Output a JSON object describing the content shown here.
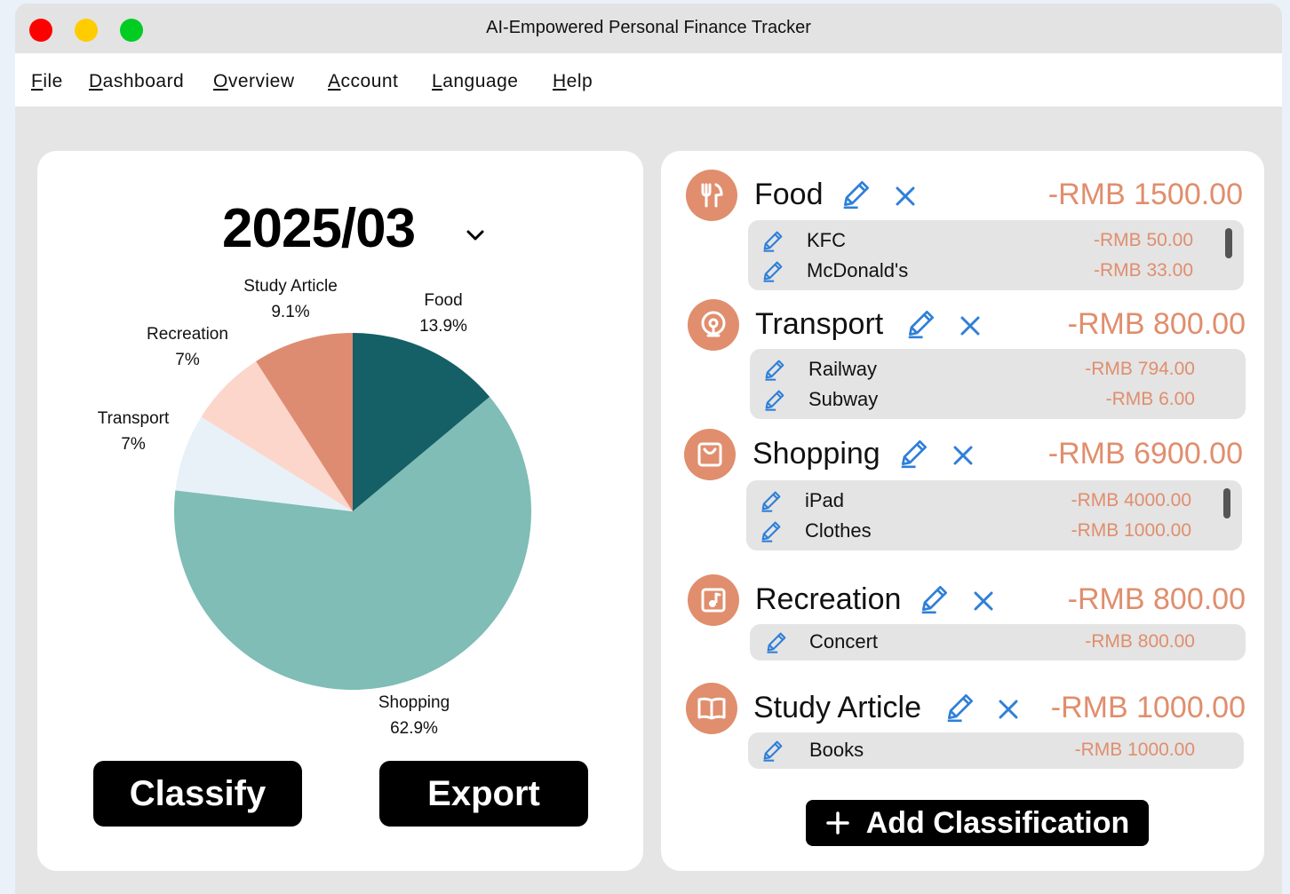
{
  "window": {
    "title": "AI-Empowered Personal Finance Tracker"
  },
  "menu": [
    {
      "key": "F",
      "rest": "ile"
    },
    {
      "key": "D",
      "rest": "ashboard"
    },
    {
      "key": "O",
      "rest": "verview"
    },
    {
      "key": "A",
      "rest": "ccount"
    },
    {
      "key": "L",
      "rest": "anguage"
    },
    {
      "key": "H",
      "rest": "elp"
    }
  ],
  "period": "2025/03",
  "buttons": {
    "classify": "Classify",
    "export": "Export",
    "add_classification": "Add Classification"
  },
  "chart_data": {
    "type": "pie",
    "slices": [
      {
        "label": "Food",
        "pct_label": "13.9%",
        "value": 13.9,
        "color": "#155f66"
      },
      {
        "label": "Shopping",
        "pct_label": "62.9%",
        "value": 62.9,
        "color": "#7fbdb6"
      },
      {
        "label": "Transport",
        "pct_label": "7%",
        "value": 7.0,
        "color": "#e8f1f8"
      },
      {
        "label": "Recreation",
        "pct_label": "7%",
        "value": 7.0,
        "color": "#fcd6cb"
      },
      {
        "label": "Study Article",
        "pct_label": "9.1%",
        "value": 9.1,
        "color": "#de8c71"
      }
    ]
  },
  "categories": [
    {
      "name": "Food",
      "icon": "utensils-icon",
      "total": "-RMB 1500.00",
      "items": [
        {
          "name": "KFC",
          "amount": "-RMB 50.00"
        },
        {
          "name": "McDonald's",
          "amount": "-RMB 33.00"
        }
      ],
      "scroll": true
    },
    {
      "name": "Transport",
      "icon": "train-icon",
      "total": "-RMB 800.00",
      "items": [
        {
          "name": "Railway",
          "amount": "-RMB 794.00"
        },
        {
          "name": "Subway",
          "amount": "-RMB 6.00"
        }
      ],
      "scroll": false
    },
    {
      "name": "Shopping",
      "icon": "shopping-bag-icon",
      "total": "-RMB 6900.00",
      "items": [
        {
          "name": "iPad",
          "amount": "-RMB 4000.00"
        },
        {
          "name": "Clothes",
          "amount": "-RMB 1000.00"
        }
      ],
      "scroll": true
    },
    {
      "name": "Recreation",
      "icon": "music-note-icon",
      "total": "-RMB 800.00",
      "items": [
        {
          "name": "Concert",
          "amount": "-RMB 800.00"
        }
      ],
      "scroll": false
    },
    {
      "name": "Study Article",
      "icon": "book-icon",
      "total": "-RMB 1000.00",
      "items": [
        {
          "name": "Books",
          "amount": "-RMB 1000.00"
        }
      ],
      "scroll": false
    }
  ],
  "colors": {
    "accent": "#e08e6d",
    "edit_blue": "#2f7fd8"
  }
}
